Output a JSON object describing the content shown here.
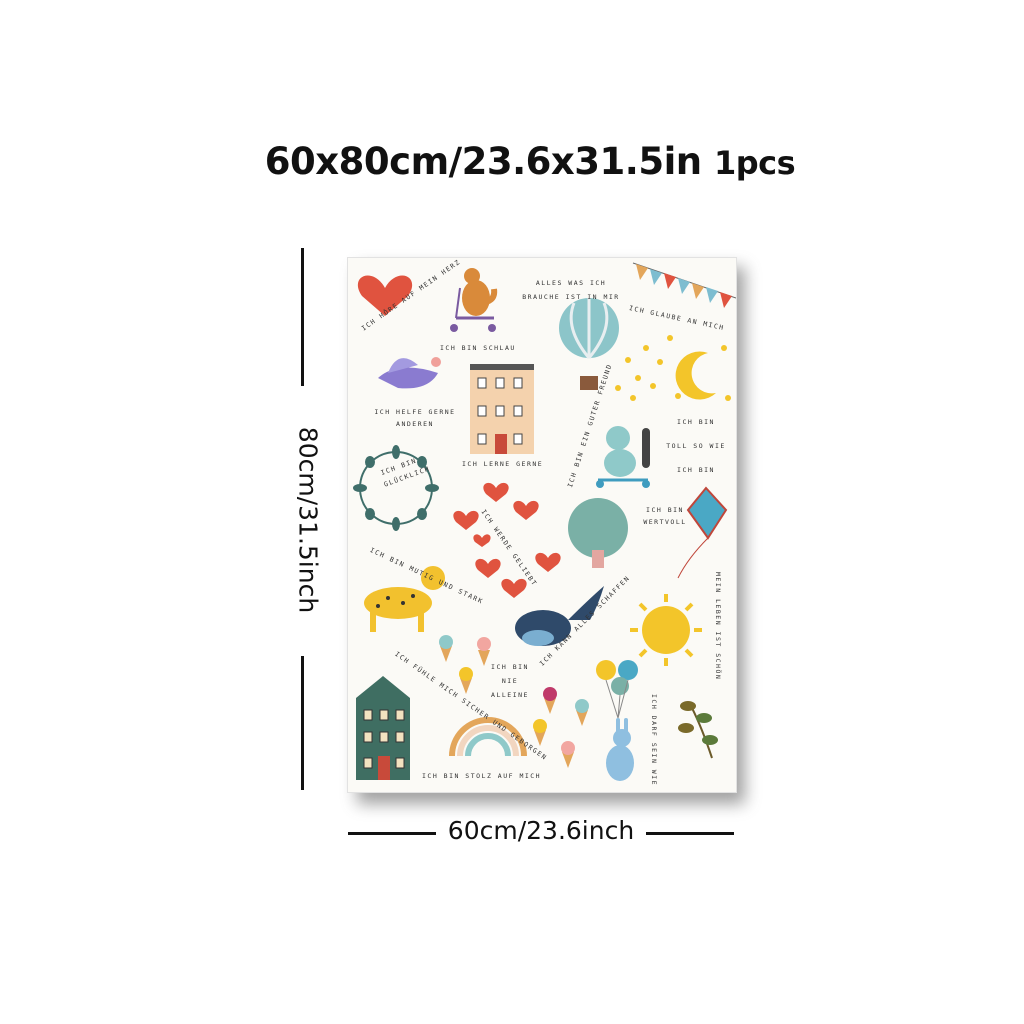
{
  "product": {
    "title_size": "60x80cm/23.6x31.5in",
    "title_qty": "1pcs",
    "width_label": "60cm/23.6inch",
    "height_label": "80cm/31.5inch"
  },
  "poster": {
    "phrases": [
      "ICH HÖRE AUF MEIN HERZ",
      "ALLES WAS ICH BRAUCHE IST IN MIR",
      "ICH BIN SCHLAU",
      "ICH GLAUBE AN MICH",
      "ICH HELFE GERNE ANDEREN",
      "ICH LERNE GERNE",
      "ICH BIN EIN GUTER FREUND",
      "ICH BIN TOLL SO WIE ICH BIN",
      "ICH BIN GLÜCKLICH",
      "ICH WERDE GELIEBT",
      "ICH BIN WERTVOLL",
      "ICH BIN MUTIG UND STARK",
      "MEIN LEBEN IST SCHÖN",
      "ICH FÜHLE MICH SICHER UND GEBORGEN",
      "ICH KANN ALLES SCHAFFEN",
      "ICH BIN NIE ALLEINE",
      "ICH DARF SEIN WIE ICH MÖCHTE",
      "ICH BIN STOLZ AUF MICH"
    ],
    "colors": {
      "heart": "#e0533f",
      "teal": "#3f6e6a",
      "yellow": "#f3c52a",
      "blue": "#7aaed0",
      "orange": "#e07a2c"
    }
  }
}
